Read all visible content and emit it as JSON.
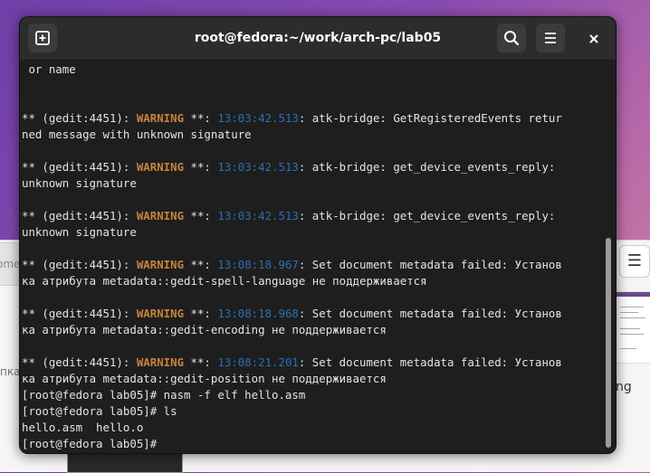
{
  "window": {
    "title": "root@fedora:~/work/arch-pc/lab05"
  },
  "background": {
    "left_tab_text": "ome",
    "left_label": "пка",
    "right_text": "ng"
  },
  "icons": {
    "new_tab": "plus-square-icon",
    "search": "search-icon",
    "menu": "hamburger-menu-icon",
    "close": "close-icon"
  },
  "colors": {
    "warning": "#c8823c",
    "timestamp": "#2a6fb5",
    "text": "#e4e4e4",
    "background": "#1e1e1e"
  },
  "terminal": {
    "lines": [
      [
        {
          "t": " or name"
        }
      ],
      [
        {
          "t": ""
        }
      ],
      [
        {
          "t": ""
        }
      ],
      [
        {
          "t": "** (gedit:4451): "
        },
        {
          "t": "WARNING",
          "c": "w"
        },
        {
          "t": " **: "
        },
        {
          "t": "13:03:42.513",
          "c": "ts"
        },
        {
          "t": ": atk-bridge: GetRegisteredEvents retur"
        }
      ],
      [
        {
          "t": "ned message with unknown signature"
        }
      ],
      [
        {
          "t": ""
        }
      ],
      [
        {
          "t": "** (gedit:4451): "
        },
        {
          "t": "WARNING",
          "c": "w"
        },
        {
          "t": " **: "
        },
        {
          "t": "13:03:42.513",
          "c": "ts"
        },
        {
          "t": ": atk-bridge: get_device_events_reply:"
        }
      ],
      [
        {
          "t": "unknown signature"
        }
      ],
      [
        {
          "t": ""
        }
      ],
      [
        {
          "t": "** (gedit:4451): "
        },
        {
          "t": "WARNING",
          "c": "w"
        },
        {
          "t": " **: "
        },
        {
          "t": "13:03:42.513",
          "c": "ts"
        },
        {
          "t": ": atk-bridge: get_device_events_reply:"
        }
      ],
      [
        {
          "t": "unknown signature"
        }
      ],
      [
        {
          "t": ""
        }
      ],
      [
        {
          "t": "** (gedit:4451): "
        },
        {
          "t": "WARNING",
          "c": "w"
        },
        {
          "t": " **: "
        },
        {
          "t": "13:08:18.967",
          "c": "ts"
        },
        {
          "t": ": Set document metadata failed: Установ"
        }
      ],
      [
        {
          "t": "ка атрибута metadata::gedit-spell-language не поддерживается"
        }
      ],
      [
        {
          "t": ""
        }
      ],
      [
        {
          "t": "** (gedit:4451): "
        },
        {
          "t": "WARNING",
          "c": "w"
        },
        {
          "t": " **: "
        },
        {
          "t": "13:08:18.968",
          "c": "ts"
        },
        {
          "t": ": Set document metadata failed: Установ"
        }
      ],
      [
        {
          "t": "ка атрибута metadata::gedit-encoding не поддерживается"
        }
      ],
      [
        {
          "t": ""
        }
      ],
      [
        {
          "t": "** (gedit:4451): "
        },
        {
          "t": "WARNING",
          "c": "w"
        },
        {
          "t": " **: "
        },
        {
          "t": "13:08:21.201",
          "c": "ts"
        },
        {
          "t": ": Set document metadata failed: Установ"
        }
      ],
      [
        {
          "t": "ка атрибута metadata::gedit-position не поддерживается"
        }
      ],
      [
        {
          "t": "[root@fedora lab05]# nasm -f elf hello.asm"
        }
      ],
      [
        {
          "t": "[root@fedora lab05]# ls"
        }
      ],
      [
        {
          "t": "hello.asm  hello.o"
        }
      ],
      [
        {
          "t": "[root@fedora lab05]# "
        }
      ]
    ]
  }
}
